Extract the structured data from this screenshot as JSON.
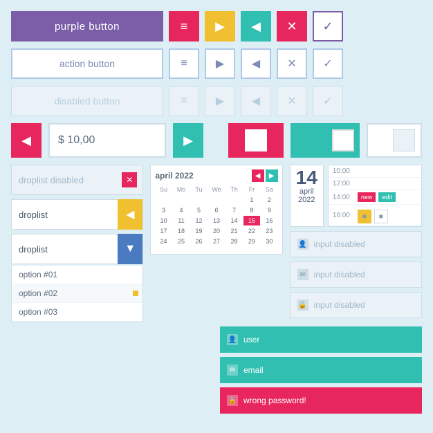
{
  "buttons": {
    "purple_label": "purple button",
    "action_label": "action button",
    "disabled_label": "disabled button"
  },
  "icons": {
    "menu": "≡",
    "play": "▶",
    "back": "◀",
    "close": "✕",
    "check": "✓",
    "arrow_down": "▼",
    "arrow_left": "◀",
    "arrow_right": "▶"
  },
  "price": {
    "value": "$ 10,00"
  },
  "droplists": {
    "disabled_label": "droplist disabled",
    "yellow_label": "droplist",
    "blue_label": "droplist",
    "options": [
      "option #01",
      "option #02",
      "option #03"
    ]
  },
  "calendar": {
    "title": "april 2022",
    "days_header": [
      "Su",
      "Mo",
      "Tu",
      "We",
      "Th",
      "Fr",
      "Sa"
    ],
    "days": [
      "",
      "",
      "",
      "",
      "",
      "1",
      "2",
      "3",
      "4",
      "5",
      "6",
      "7",
      "8",
      "9",
      "10",
      "11",
      "12",
      "13",
      "14",
      "15",
      "16",
      "17",
      "18",
      "19",
      "20",
      "21",
      "22",
      "23",
      "24",
      "25",
      "26",
      "27",
      "28",
      "29",
      "30",
      ""
    ],
    "today": "15"
  },
  "appointment": {
    "day": "14",
    "month": "april",
    "year": "2022",
    "times": [
      "10:00",
      "12:00",
      "14:00",
      "16:00"
    ],
    "new_btn": "new",
    "edit_btn": "edit"
  },
  "inputs": {
    "disabled1_placeholder": "input disabled",
    "disabled2_placeholder": "input disabled",
    "disabled3_placeholder": "input disabled",
    "user_label": "user",
    "email_label": "email",
    "error_label": "wrong password!"
  }
}
